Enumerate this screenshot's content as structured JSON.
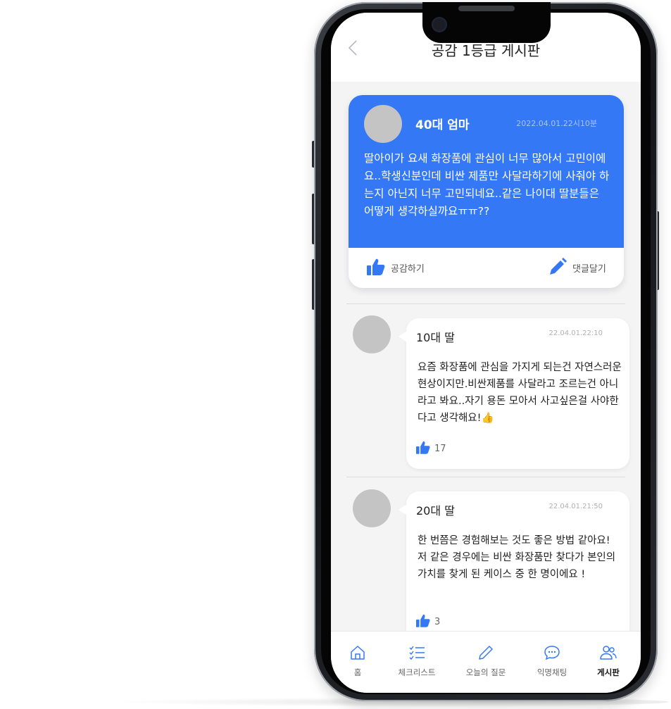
{
  "header": {
    "title": "공감 1등급 게시판",
    "back_icon": "chevron-left-icon"
  },
  "main_post": {
    "author": "40대 엄마",
    "date": "2022.04.01.22시10분",
    "body": "딸아이가 요새 화장품에 관심이 너무 많아서 고민이에요..학생신분인데 비싼 제품만 사달라하기에 사줘야 하는지 아닌지 너무 고민되네요..같은 나이대 딸분들은 어떻게 생각하실까요ㅠㅠ??",
    "like_label": "공감하기",
    "comment_label": "댓글달기",
    "accent_color": "#3478f6"
  },
  "comments": [
    {
      "author": "10대 딸",
      "date": "22.04.01.22:10",
      "body": "요즘 화장품에 관심을 가지게 되는건 자연스러운 현상이지만.비싼제품를 사달라고 조르는건 아니라고 봐요..자기 용돈 모아서 사고싶은걸 사야한다고 생각해요!👍",
      "likes": "17"
    },
    {
      "author": "20대 딸",
      "date": "22.04.01.21:50",
      "body": "한 번쯤은 경험해보는 것도 좋은 방법 같아요! 저 같은 경우에는 비싼 화장품만 찾다가 본인의 가치를 찾게 된 케이스 중 한 명이에요 !",
      "likes": "3"
    }
  ],
  "nav": {
    "items": [
      {
        "label": "홈",
        "icon": "home-icon"
      },
      {
        "label": "체크리스트",
        "icon": "checklist-icon"
      },
      {
        "label": "오늘의 질문",
        "icon": "pencil-icon"
      },
      {
        "label": "익명채팅",
        "icon": "chat-bubble-icon"
      },
      {
        "label": "게시판",
        "icon": "users-icon"
      }
    ],
    "active": "게시판"
  }
}
